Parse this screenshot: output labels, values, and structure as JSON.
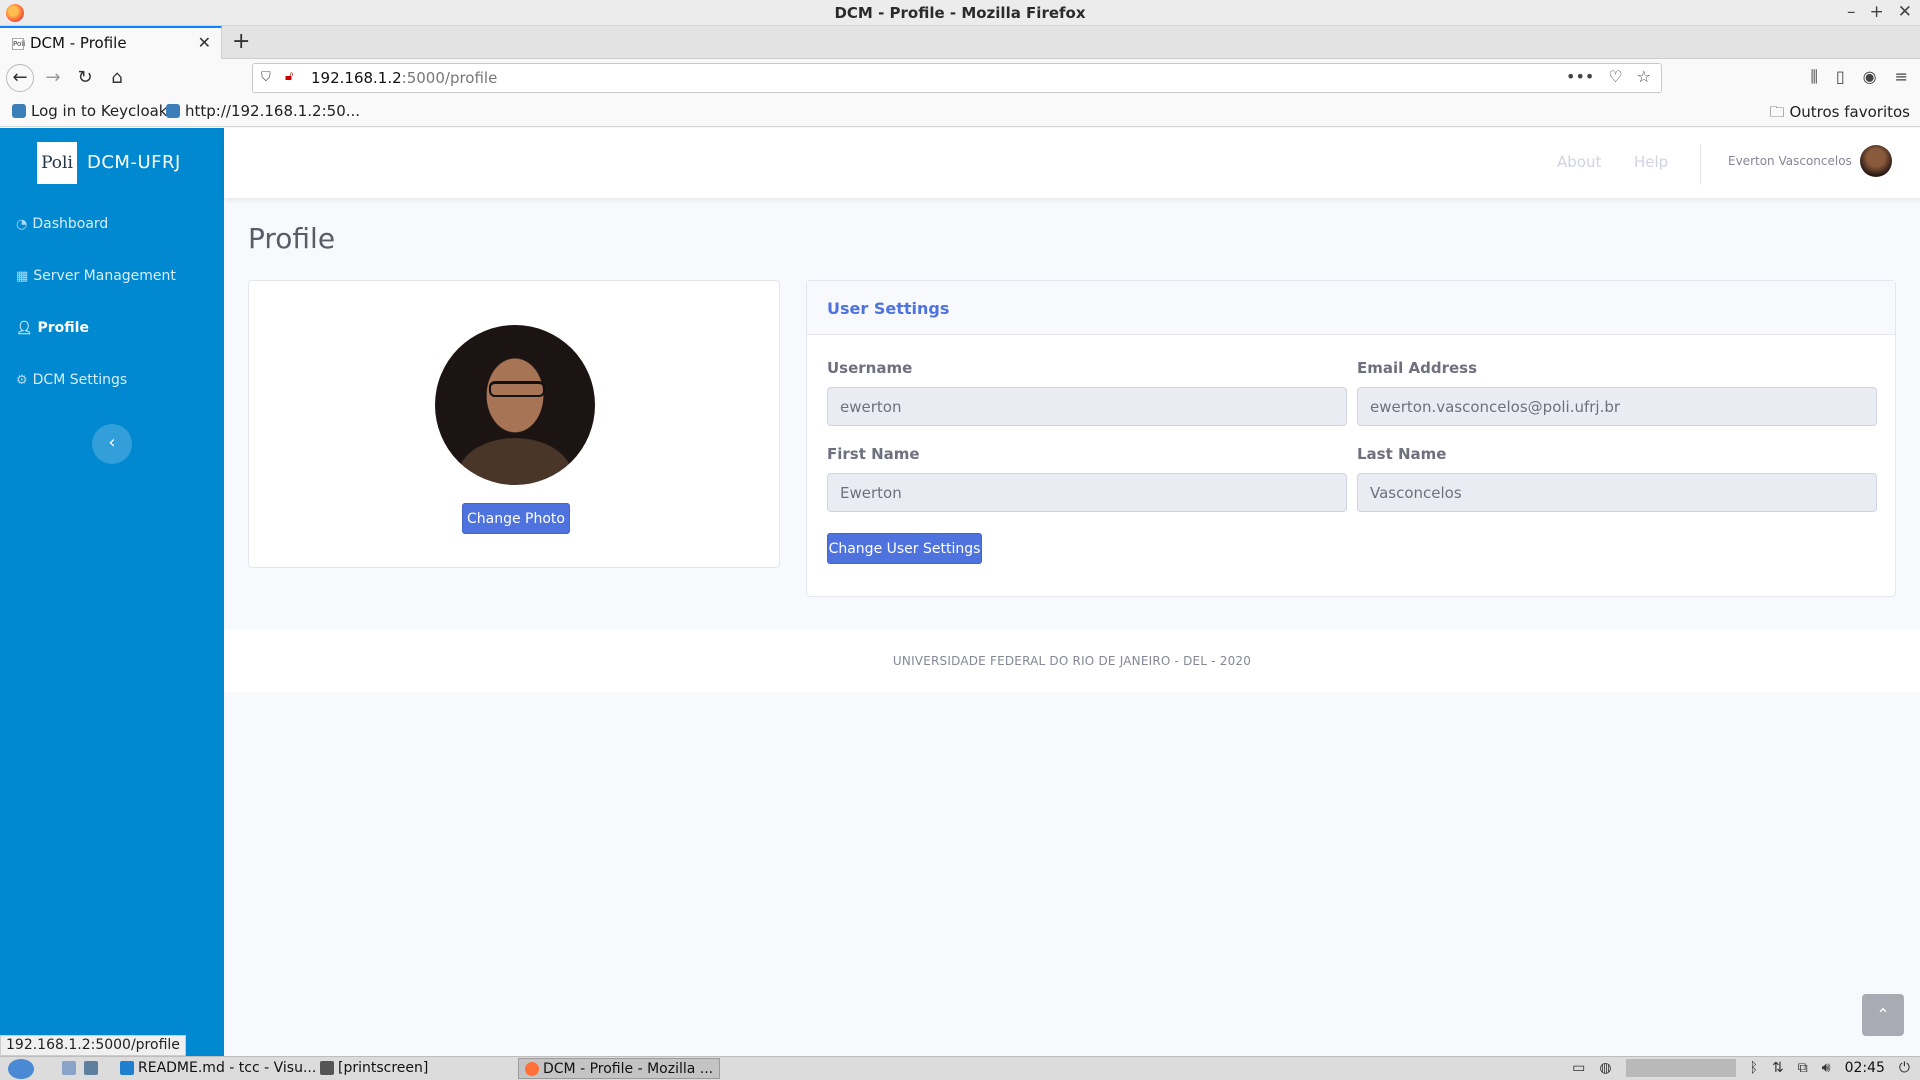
{
  "window": {
    "title": "DCM - Profile - Mozilla Firefox",
    "controls": [
      "–",
      "+",
      "✕"
    ]
  },
  "tab": {
    "favicon_text": "Poli",
    "title": "DCM - Profile",
    "close": "✕",
    "new_tab": "+"
  },
  "nav": {
    "back": "←",
    "forward": "→",
    "reload": "↻",
    "home": "⌂",
    "url_host": "192.168.1.2",
    "url_path": ":5000/profile",
    "url_actions": [
      "•••",
      "♡",
      "☆"
    ],
    "toolbar_icons": [
      "library-icon",
      "sidebar-icon",
      "account-icon",
      "menu-icon"
    ]
  },
  "bookmarks": {
    "items": [
      "Log in to Keycloak",
      "http://192.168.1.2:50..."
    ],
    "folder": "Outros favoritos"
  },
  "sidebar": {
    "logo": "Poli",
    "brand": "DCM-UFRJ",
    "items": [
      {
        "label": "Dashboard",
        "icon": "tachometer-icon"
      },
      {
        "label": "Server Management",
        "icon": "table-icon"
      },
      {
        "label": "Profile",
        "icon": "user-icon"
      },
      {
        "label": "DCM Settings",
        "icon": "cogs-icon"
      }
    ],
    "toggle": "‹"
  },
  "topbar": {
    "links": [
      "About",
      "Help"
    ],
    "user_name": "Everton Vasconcelos"
  },
  "main": {
    "title": "Profile",
    "photo_card": {
      "button": "Change Photo"
    },
    "settings_card": {
      "header": "User Settings",
      "fields": {
        "username": {
          "label": "Username",
          "value": "ewerton"
        },
        "email": {
          "label": "Email Address",
          "value": "ewerton.vasconcelos@poli.ufrj.br"
        },
        "first_name": {
          "label": "First Name",
          "value": "Ewerton"
        },
        "last_name": {
          "label": "Last Name",
          "value": "Vasconcelos"
        }
      },
      "button": "Change User Settings"
    }
  },
  "footer": {
    "text": "UNIVERSIDADE FEDERAL DO RIO DE JANEIRO - DEL - 2020"
  },
  "status_bar": {
    "url": "192.168.1.2:5000/profile"
  },
  "taskbar": {
    "items": [
      "README.md - tcc - Visu...",
      "[printscreen]",
      "DCM - Profile - Mozilla ..."
    ],
    "clock": "02:45"
  },
  "colors": {
    "sidebar": "#0088d1",
    "primary": "#4e73df",
    "page_bg": "#f8f9fc"
  }
}
